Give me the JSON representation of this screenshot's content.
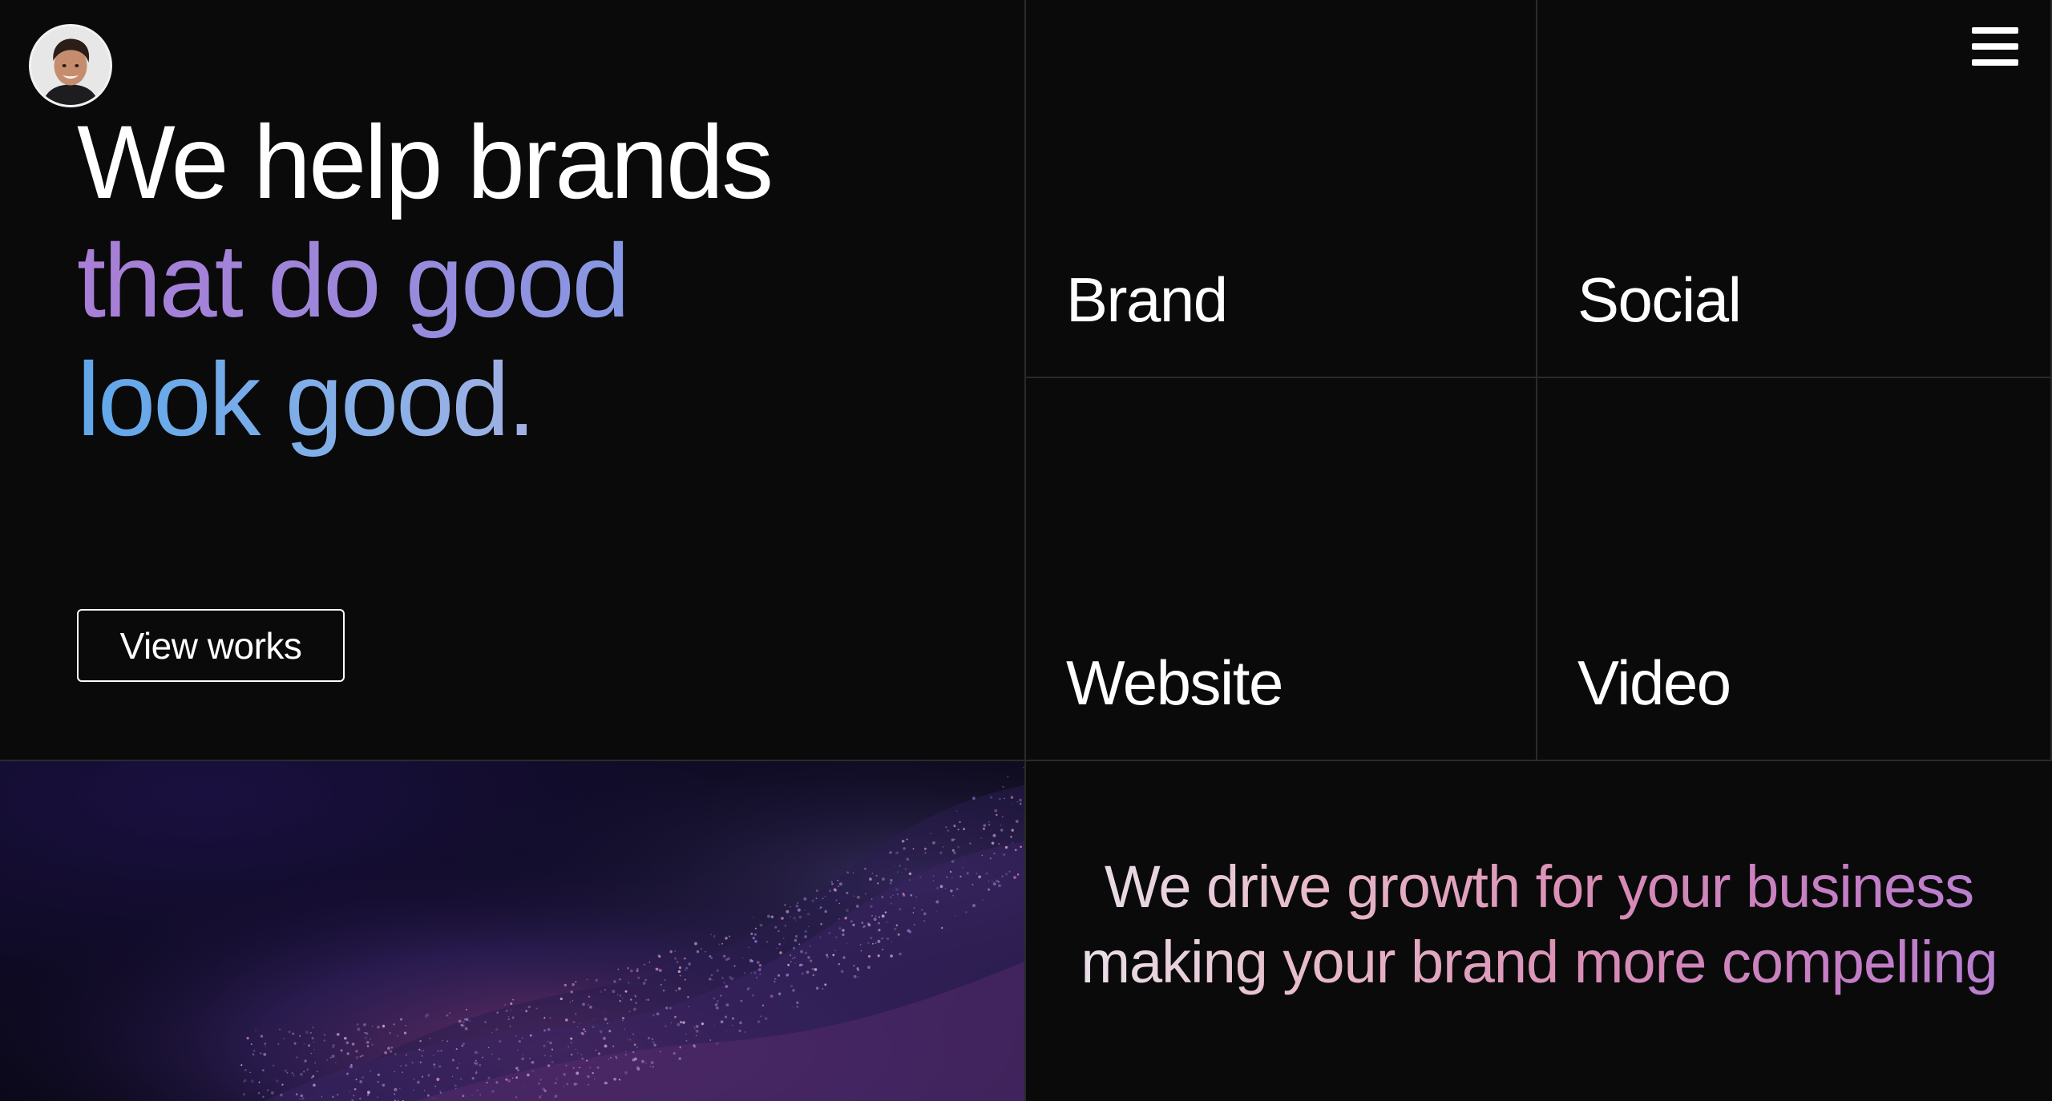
{
  "hero": {
    "avatar_alt": "",
    "headline": {
      "line1": "We help brands",
      "line2": "that do good",
      "line3": "look good."
    },
    "cta_label": "View works"
  },
  "services": [
    {
      "label": "Brand"
    },
    {
      "label": "Social"
    },
    {
      "label": "Website"
    },
    {
      "label": "Video"
    }
  ],
  "menu": {
    "icon": "hamburger-menu-icon"
  },
  "statement": {
    "text": "We drive growth for your business making your brand more compelling"
  },
  "colors": {
    "background": "#0a0a0a",
    "divider": "#2a2a2a",
    "gradient_purple": "#a97ed6",
    "gradient_blue": "#5fa7ea",
    "gradient_pink": "#d98cb4"
  }
}
